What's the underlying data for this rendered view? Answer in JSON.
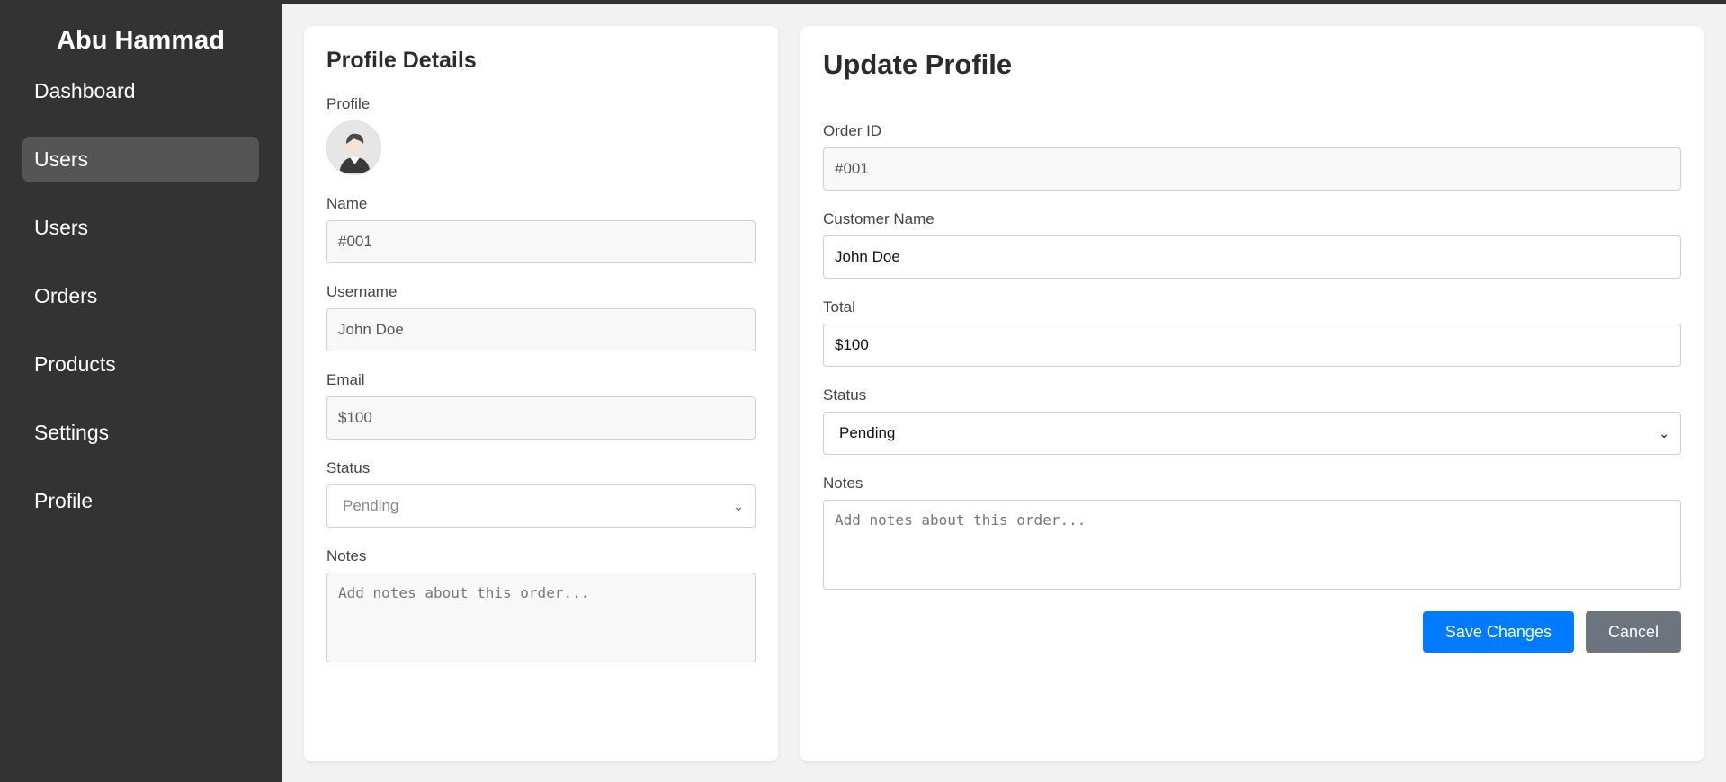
{
  "sidebar": {
    "brand": "Abu Hammad",
    "items": [
      {
        "label": "Dashboard",
        "active": false
      },
      {
        "label": "Users",
        "active": true
      },
      {
        "label": "Users",
        "active": false
      },
      {
        "label": "Orders",
        "active": false
      },
      {
        "label": "Products",
        "active": false
      },
      {
        "label": "Settings",
        "active": false
      },
      {
        "label": "Profile",
        "active": false
      }
    ]
  },
  "profile_details": {
    "title": "Profile Details",
    "profile_label": "Profile",
    "name_label": "Name",
    "name_value": "#001",
    "username_label": "Username",
    "username_value": "John Doe",
    "email_label": "Email",
    "email_value": "$100",
    "status_label": "Status",
    "status_value": "Pending",
    "notes_label": "Notes",
    "notes_placeholder": "Add notes about this order..."
  },
  "update_profile": {
    "title": "Update Profile",
    "order_id_label": "Order ID",
    "order_id_value": "#001",
    "customer_name_label": "Customer Name",
    "customer_name_value": "John Doe",
    "total_label": "Total",
    "total_value": "$100",
    "status_label": "Status",
    "status_value": "Pending",
    "notes_label": "Notes",
    "notes_placeholder": "Add notes about this order...",
    "save_label": "Save Changes",
    "cancel_label": "Cancel"
  },
  "colors": {
    "sidebar_bg": "#333333",
    "active_item_bg": "#555555",
    "primary": "#007bff",
    "secondary": "#6c757d"
  },
  "icons": {
    "avatar": "user-avatar-icon",
    "select": "chevron-down-icon"
  }
}
